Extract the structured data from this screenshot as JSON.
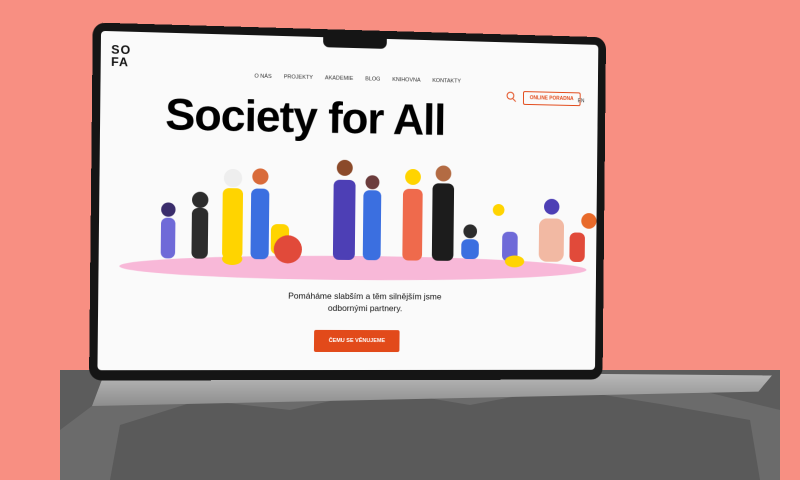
{
  "site": {
    "logo": "SO\nFA",
    "nav": [
      "O NÁS",
      "PROJEKTY",
      "AKADEMIE",
      "BLOG",
      "KNIHOVNA",
      "KONTAKTY"
    ],
    "cta_label": "ONLINE PORADNA",
    "lang_label": "EN",
    "headline": "Society for All",
    "subtitle": "Pomáháme slabším a těm silnějším jsme odbornými partnery.",
    "primary_button": "ČEMU SE VĚNUJEME"
  },
  "colors": {
    "accent": "#e24a1a",
    "background": "#f88f82"
  }
}
